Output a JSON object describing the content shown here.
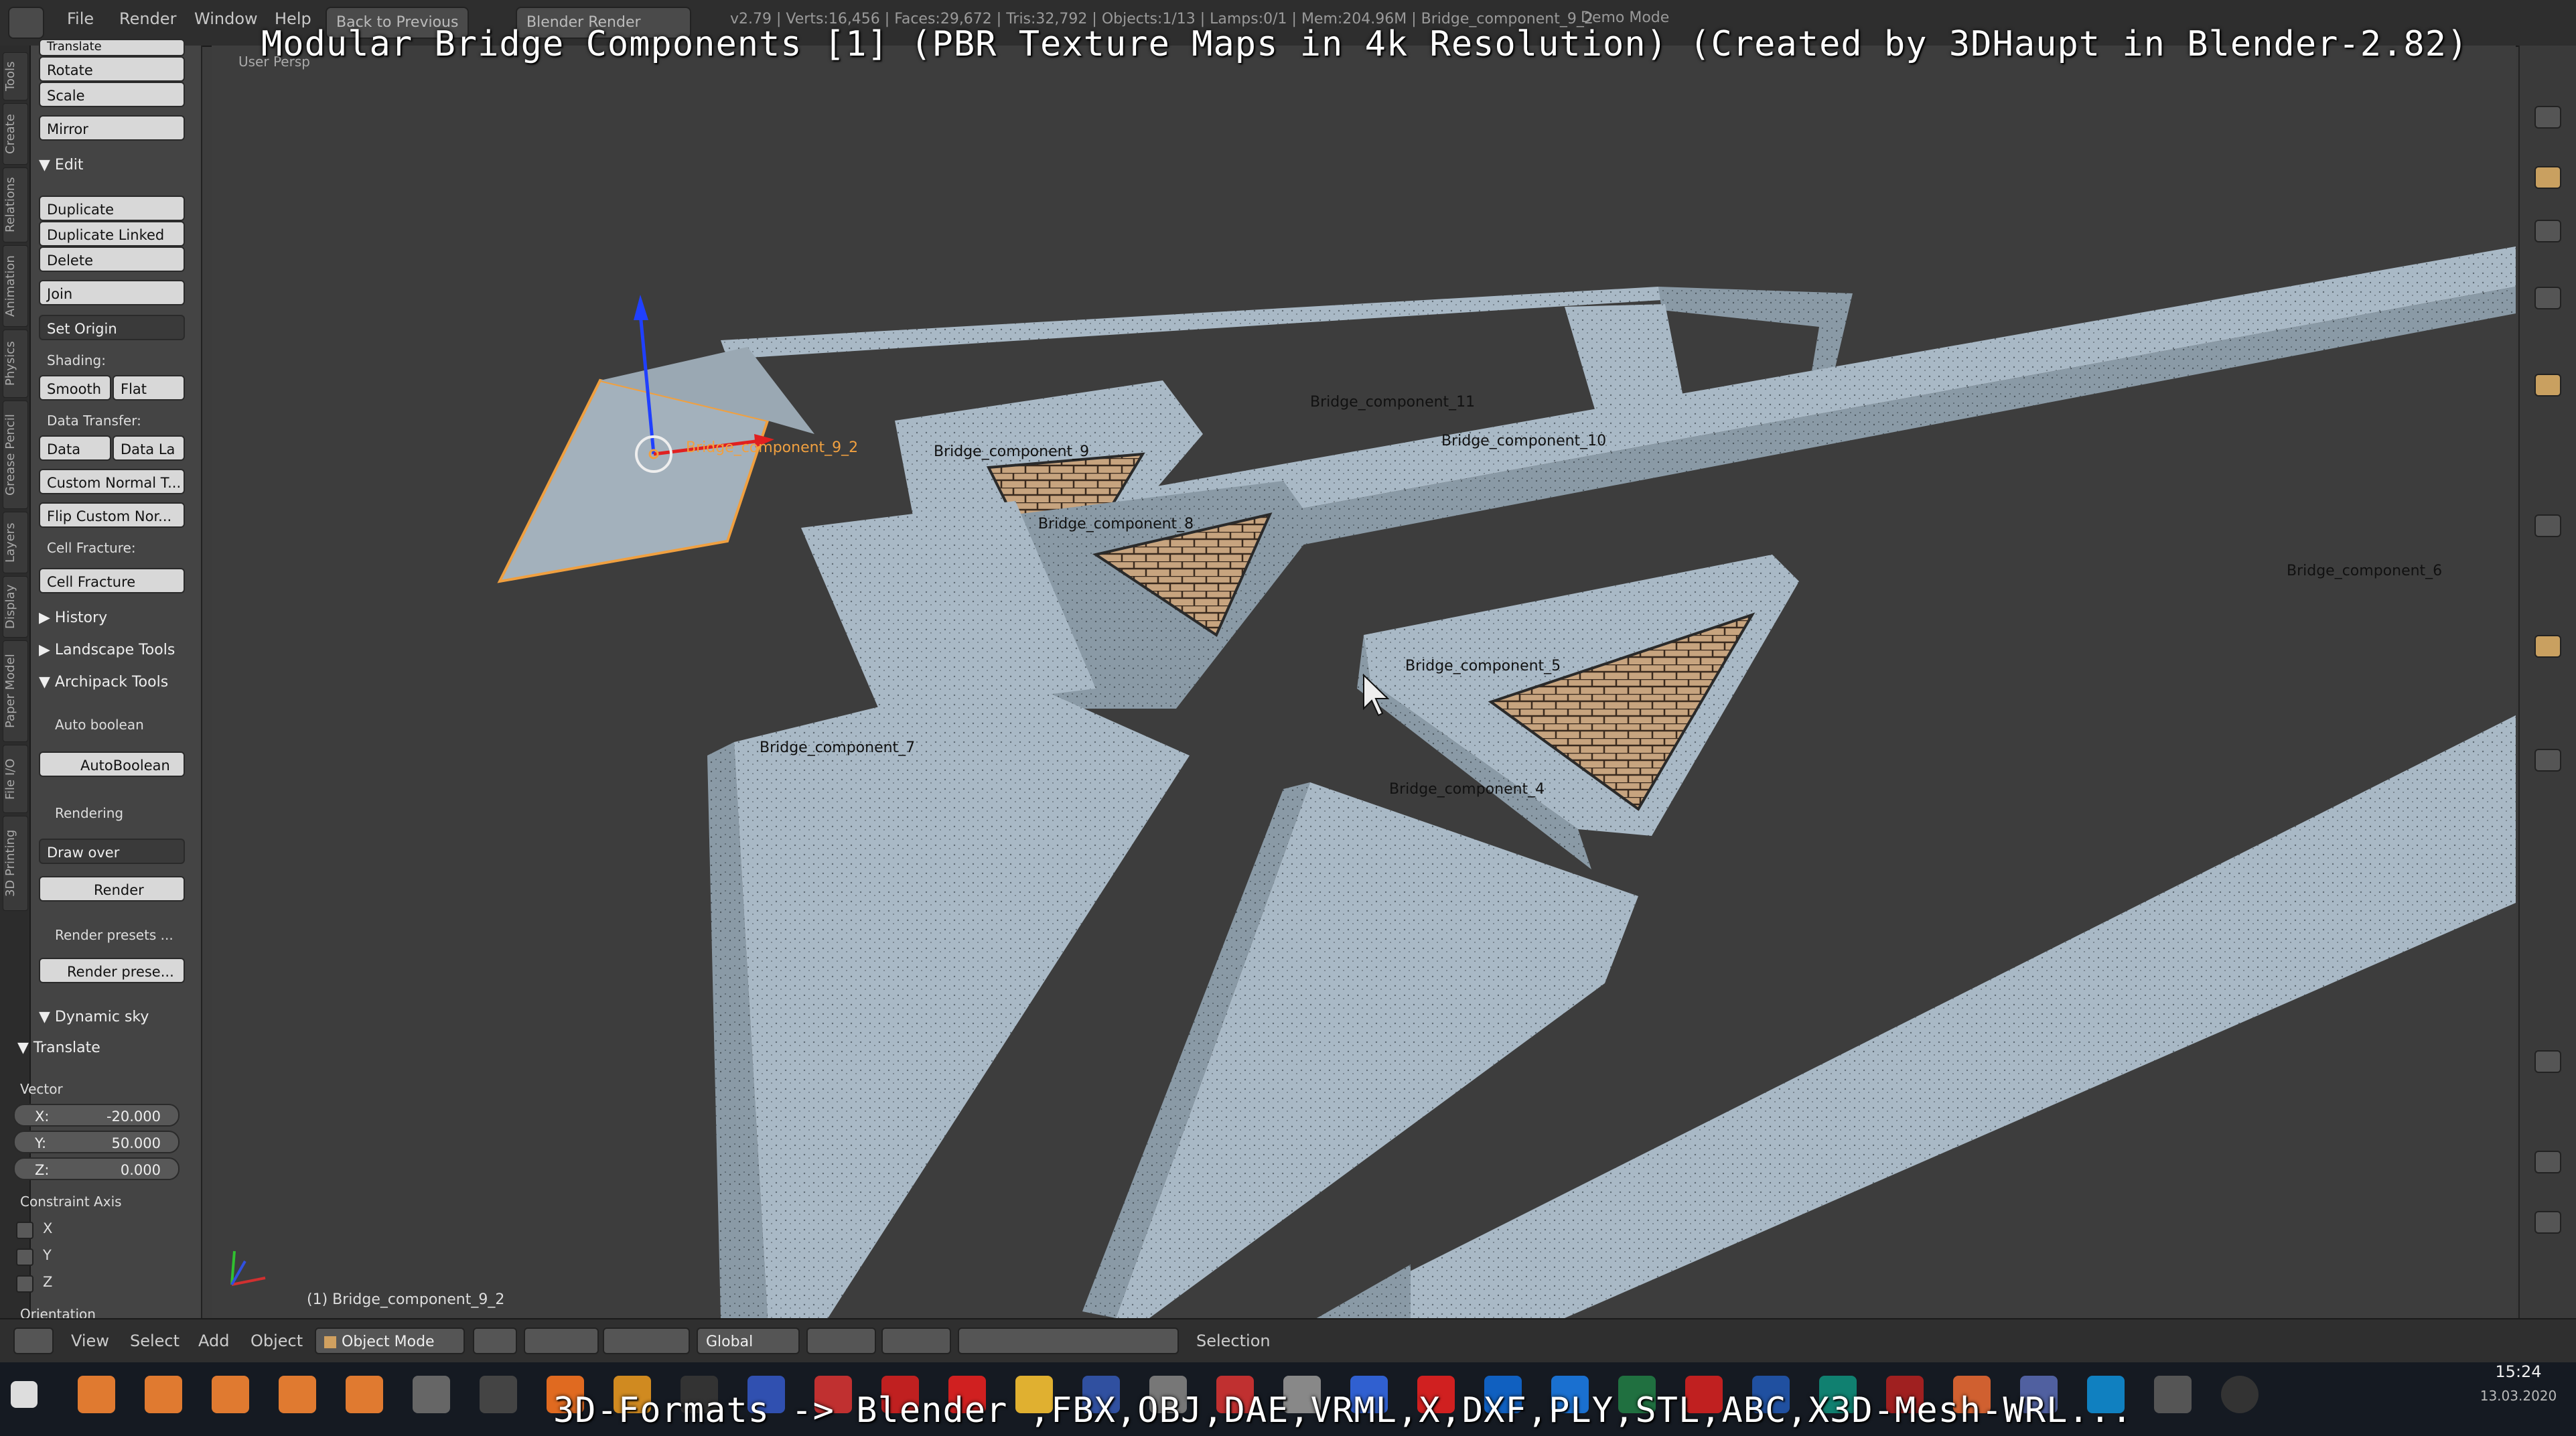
{
  "overlay": {
    "title": "Modular Bridge Components [1] (PBR Texture Maps in 4k Resolution) (Created by 3DHaupt in Blender-2.82)",
    "bottom": "3D-Formats -> Blender ,FBX,OBJ,DAE,VRML,X,DXF,PLY,STL,ABC,X3D-Mesh-WRL..."
  },
  "topbar": {
    "menus": [
      "File",
      "Render",
      "Window",
      "Help"
    ],
    "back_button": "Back to Previous",
    "engine": "Blender Render",
    "stats": "v2.79 | Verts:16,456 | Faces:29,672 | Tris:32,792 | Objects:1/13 | Lamps:0/1 | Mem:204.96M | Bridge_component_9_2",
    "mode_right": "Demo Mode"
  },
  "tabs": [
    "Tools",
    "Create",
    "Relations",
    "Animation",
    "Physics",
    "Grease Pencil",
    "Layers",
    "Display",
    "Paper Model",
    "File I/O",
    "3D Printing"
  ],
  "toolshelf": {
    "translate_cut": "Translate",
    "rotate": "Rotate",
    "scale": "Scale",
    "mirror": "Mirror",
    "edit_header": "Edit",
    "duplicate": "Duplicate",
    "duplicate_linked": "Duplicate Linked",
    "delete": "Delete",
    "join": "Join",
    "set_origin": "Set Origin",
    "shading_label": "Shading:",
    "smooth": "Smooth",
    "flat": "Flat",
    "data_transfer_label": "Data Transfer:",
    "data": "Data",
    "data_la": "Data La",
    "custom_normal": "Custom Normal T...",
    "flip_custom": "Flip Custom Nor...",
    "cell_fracture_label": "Cell Fracture:",
    "cell_fracture": "Cell Fracture",
    "history": "History",
    "landscape_tools": "Landscape Tools",
    "archipack_tools": "Archipack Tools",
    "auto_boolean_label": "Auto boolean",
    "autoboolean": "AutoBoolean",
    "rendering_label": "Rendering",
    "draw_over": "Draw over",
    "render": "Render",
    "render_presets_label": "Render presets ...",
    "render_presets": "Render prese...",
    "dynamic_sky": "Dynamic sky",
    "translate_header": "Translate",
    "vector_label": "Vector",
    "x_label": "X:",
    "x_value": "-20.000",
    "y_label": "Y:",
    "y_value": "50.000",
    "z_label": "Z:",
    "z_value": "0.000",
    "constraint_label": "Constraint Axis",
    "cx": "X",
    "cy": "Y",
    "cz": "Z",
    "orientation": "Orientation"
  },
  "viewport": {
    "view_name": "User Persp",
    "selected_object": "(1) Bridge_component_9_2",
    "labels": {
      "c11": "Bridge_component_11",
      "c10": "Bridge_component_10",
      "c9": "Bridge_component_9",
      "c92": "Bridge_component_9_2",
      "c8": "Bridge_component_8",
      "c7": "Bridge_component_7",
      "c6": "Bridge_component_6",
      "c5": "Bridge_component_5",
      "c4": "Bridge_component_4"
    }
  },
  "statusbar": {
    "view": "View",
    "select": "Select",
    "add": "Add",
    "object": "Object",
    "mode": "Object Mode",
    "orientation": "Global",
    "selection": "Selection"
  },
  "taskbar": {
    "time": "15:24",
    "date": "13.03.2020"
  },
  "colors": {
    "concrete": "#a9b9c6",
    "concrete_dark": "#7c8b97",
    "brick": "#c19d78",
    "viewport_bg": "#3d3d3d",
    "selection_orange": "#f0a040"
  }
}
